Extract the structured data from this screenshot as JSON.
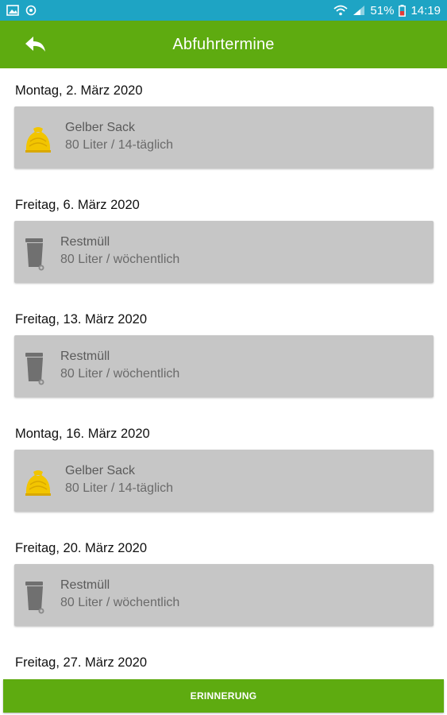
{
  "status_bar": {
    "battery": "51%",
    "time": "14:19",
    "icons": [
      "gallery-icon",
      "vpn-icon",
      "wifi-icon",
      "signal-icon",
      "battery-icon"
    ]
  },
  "app_bar": {
    "title": "Abfuhrtermine",
    "back_icon": "back-arrow-icon"
  },
  "colors": {
    "status_bar": "#1ea4c4",
    "accent": "#5eab10",
    "card": "#c6c6c6",
    "yellow_sack": "#f2c500",
    "bin": "#707070"
  },
  "entries": [
    {
      "date": "Montag, 2. März 2020",
      "type": "Gelber Sack",
      "details": "80 Liter / 14-täglich",
      "icon": "yellow-sack-icon"
    },
    {
      "date": "Freitag, 6. März 2020",
      "type": "Restmüll",
      "details": "80 Liter / wöchentlich",
      "icon": "trash-bin-icon"
    },
    {
      "date": "Freitag, 13. März 2020",
      "type": "Restmüll",
      "details": "80 Liter / wöchentlich",
      "icon": "trash-bin-icon"
    },
    {
      "date": "Montag, 16. März 2020",
      "type": "Gelber Sack",
      "details": "80 Liter / 14-täglich",
      "icon": "yellow-sack-icon"
    },
    {
      "date": "Freitag, 20. März 2020",
      "type": "Restmüll",
      "details": "80 Liter / wöchentlich",
      "icon": "trash-bin-icon"
    },
    {
      "date": "Freitag, 27. März 2020"
    }
  ],
  "button": {
    "label": "ERINNERUNG"
  }
}
